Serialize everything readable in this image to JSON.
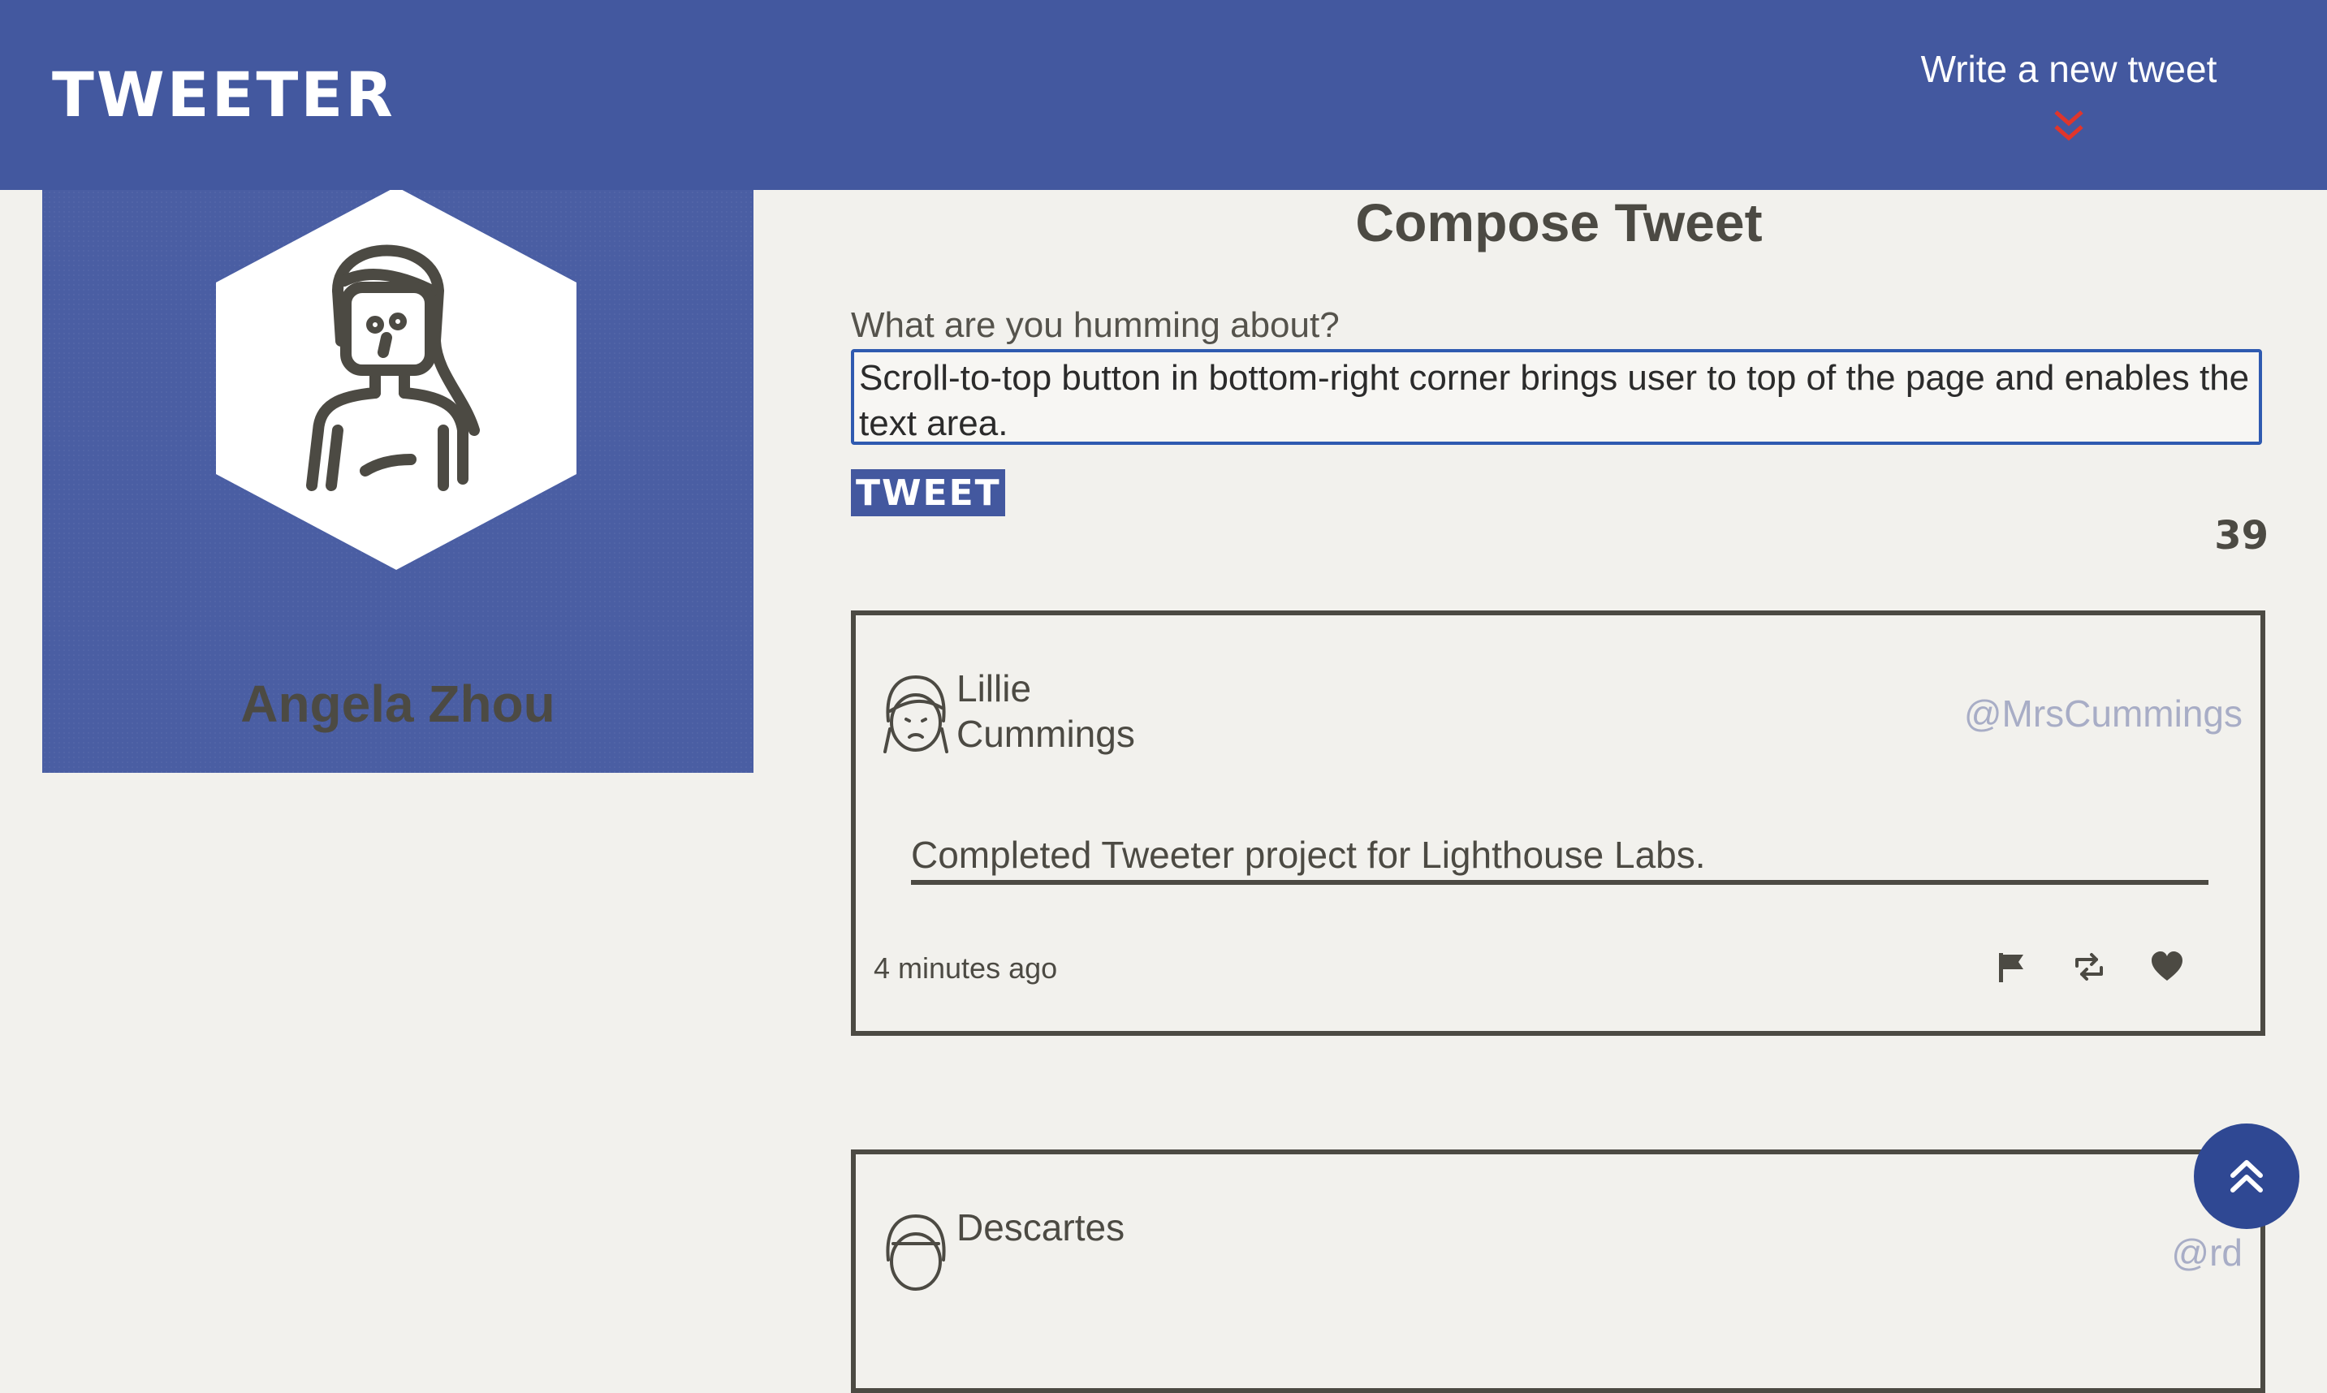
{
  "nav": {
    "brand": "TWEETER",
    "write_new": "Write a new tweet"
  },
  "profile": {
    "name": "Angela Zhou"
  },
  "compose": {
    "title": "Compose Tweet",
    "prompt_label": "What are you humming about?",
    "textarea_value": "Scroll-to-top button in bottom-right corner brings user to top of the page and enables the text area.",
    "tweet_button": "TWEET",
    "counter": "39"
  },
  "tweets": [
    {
      "author_first": "Lillie",
      "author_last": "Cummings",
      "handle": "@MrsCummings",
      "content": "Completed Tweeter project for Lighthouse Labs.",
      "timestamp": "4 minutes ago",
      "actions": [
        "flag-icon",
        "retweet-icon",
        "heart-icon"
      ]
    },
    {
      "author_first": "Descartes",
      "handle": "@rd"
    }
  ],
  "colors": {
    "nav_bg": "#43589f",
    "page_bg": "#f2f1ed",
    "text": "#4c4a43",
    "accent_red": "#e0352b",
    "handle": "#a8adc6",
    "scroll_button": "#2f4893"
  }
}
